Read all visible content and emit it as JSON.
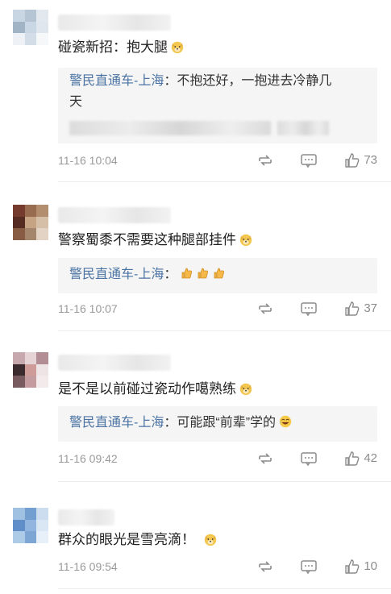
{
  "comments": [
    {
      "text": "碰瓷新招：抱大腿",
      "reply": {
        "author": "警民直通车-上海",
        "sep": "：",
        "text_line1": "不抱还好，一抱进去冷静几",
        "text_line2": "天"
      },
      "time": "11-16 10:04",
      "likes": "73",
      "avatar_colors": [
        "#c7d5e4",
        "#b4c5d6",
        "#e1e8ef",
        "#9fb4c8",
        "#c8d6e5",
        "#dfe6ee",
        "#eef2f6",
        "#d2dde8",
        "#f5f7f9"
      ]
    },
    {
      "text": "警察蜀黍不需要这种腿部挂件",
      "reply": {
        "author": "警民直通车-上海",
        "sep": "：",
        "text_line1": ""
      },
      "time": "11-16 10:07",
      "likes": "37",
      "avatar_colors": [
        "#7a3b2a",
        "#9c6b4d",
        "#b58c6a",
        "#5a2a20",
        "#c9a27e",
        "#d8bfa4",
        "#8c5a3f",
        "#a7856a",
        "#e3d3c2"
      ]
    },
    {
      "text": "是不是以前碰过瓷动作噶熟练",
      "reply": {
        "author": "警民直通车-上海",
        "sep": "：",
        "text_line1": "可能跟“前辈”学的"
      },
      "time": "11-16 09:42",
      "likes": "42",
      "avatar_colors": [
        "#caa7ae",
        "#e7d3d6",
        "#b58c93",
        "#3d2b2e",
        "#d49a97",
        "#efe4e5",
        "#7b5a5f",
        "#c79ba0",
        "#f3eaeb"
      ]
    },
    {
      "text": "群众的眼光是雪亮滴！",
      "time": "11-16 09:54",
      "likes": "10",
      "avatar_colors": [
        "#9ec1e6",
        "#6f9fd6",
        "#c9ddf1",
        "#5b8fcf",
        "#8db6e3",
        "#d8e7f6",
        "#aacbeb",
        "#7aa7db",
        "#e6f0fa"
      ]
    }
  ],
  "icons": {
    "repost": "repost-icon",
    "comment": "comment-icon",
    "like": "thumbs-up-icon",
    "emoji": "doge-emoji",
    "thumbs": "thumbs-up-emoji",
    "laugh": "laugh-emoji"
  },
  "colors": {
    "author_link": "#4b73a4",
    "meta_gray": "#9a9a9a",
    "reply_bg": "#f5f5f5"
  }
}
